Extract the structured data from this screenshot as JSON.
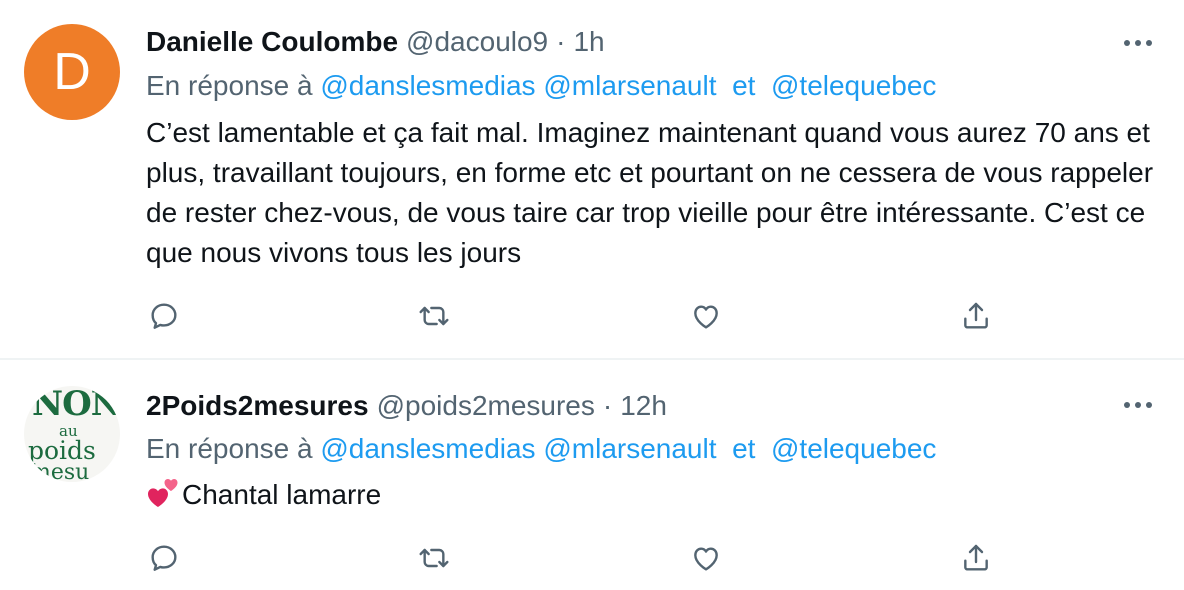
{
  "tweets": [
    {
      "avatar_letter": "D",
      "author_name": "Danielle Coulombe",
      "handle": "@dacoulo9",
      "time": "1h",
      "reply_prefix": "En réponse à",
      "mentions": [
        "@danslesmedias",
        "@mlarsenault",
        "@telequebec"
      ],
      "mention_joiner": "et",
      "text": "C’est lamentable et ça fait mal. Imaginez maintenant quand vous aurez 70 ans et plus, travaillant toujours, en forme etc et pourtant on ne cessera de vous rappeler de rester chez-vous, de vous taire car trop vieille pour être intéressante. C’est ce que nous vivons tous les jours",
      "avatar_color": "#ef7d28"
    },
    {
      "avatar_logo": [
        "NON",
        "au",
        "poids",
        "mesu"
      ],
      "author_name": "2Poids2mesures",
      "handle": "@poids2mesures",
      "time": "12h",
      "reply_prefix": "En réponse à",
      "mentions": [
        "@danslesmedias",
        "@mlarsenault",
        "@telequebec"
      ],
      "mention_joiner": "et",
      "text": "Chantal lamarre",
      "emoji": "two-hearts",
      "avatar_color": "#1c6b3f"
    }
  ],
  "separator": "·",
  "icons": {
    "more": "more-horizontal-icon",
    "reply": "reply-icon",
    "retweet": "retweet-icon",
    "like": "like-icon",
    "share": "share-icon"
  },
  "colors": {
    "text": "#0f1419",
    "secondary": "#536471",
    "link": "#1d9bf0",
    "border": "#eff3f4"
  }
}
